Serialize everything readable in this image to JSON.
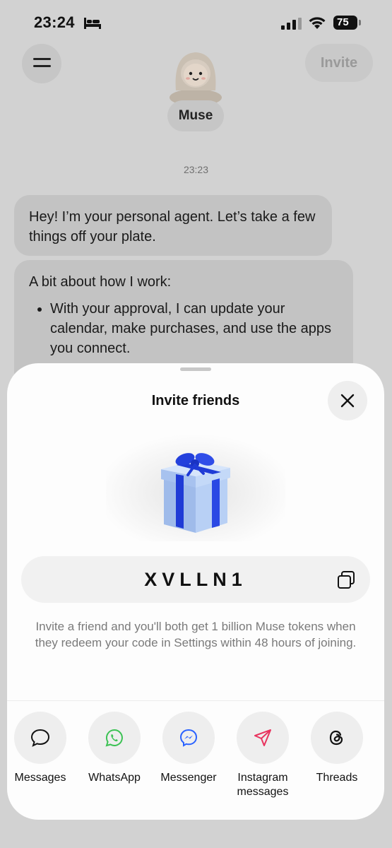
{
  "status_bar": {
    "time": "23:24",
    "battery": "75"
  },
  "chat": {
    "invite_label": "Invite",
    "agent_name": "Muse",
    "timestamp": "23:23",
    "message1": "Hey! I’m your personal agent. Let’s take a few things off your plate.",
    "message2_intro": "A bit about how I work:",
    "message2_bullet": "With your approval, I can update your calendar, make purchases, and use the apps you connect."
  },
  "sheet": {
    "title": "Invite friends",
    "invite_code": "XVLLN1",
    "description": "Invite a friend and you'll both get 1 billion Muse tokens when they redeem your code in Settings within 48 hours of joining.",
    "share_options": [
      {
        "label": "Messages",
        "icon": "chat-bubble-icon"
      },
      {
        "label": "WhatsApp",
        "icon": "whatsapp-icon"
      },
      {
        "label": "Messenger",
        "icon": "messenger-icon"
      },
      {
        "label": "Instagram messages",
        "icon": "paper-plane-icon"
      },
      {
        "label": "Threads",
        "icon": "threads-icon"
      }
    ]
  },
  "colors": {
    "whatsapp": "#3cc254",
    "messenger": "#2a62ff",
    "instagram": "#e8345f",
    "gift_ribbon": "#1f3bd6",
    "gift_box": "#a9c6f2"
  }
}
